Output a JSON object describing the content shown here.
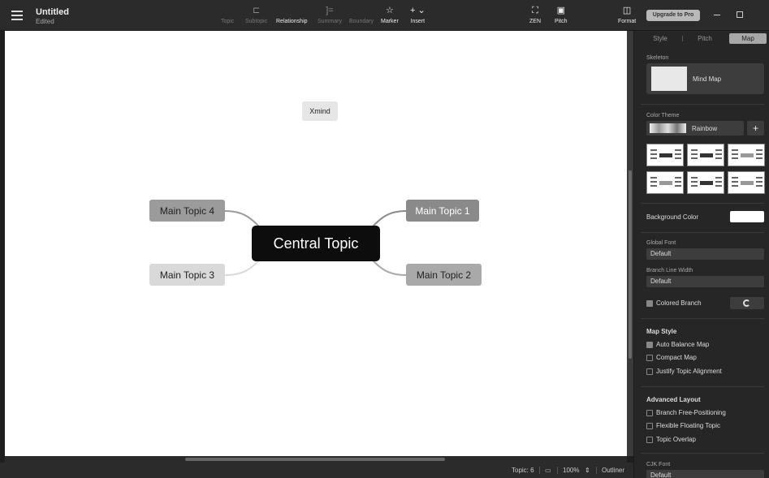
{
  "header": {
    "title": "Untitled",
    "status": "Edited",
    "upgrade_label": "Upgrade to Pro"
  },
  "toolbar": {
    "items": [
      {
        "label": "Topic",
        "icon": "topic-icon",
        "glyph": ""
      },
      {
        "label": "Subtopic",
        "icon": "subtopic-icon",
        "glyph": "⊏"
      },
      {
        "label": "Relationship",
        "icon": "relationship-icon",
        "glyph": ""
      },
      {
        "label": "Summary",
        "icon": "summary-icon",
        "glyph": "]="
      },
      {
        "label": "Boundary",
        "icon": "boundary-icon",
        "glyph": ""
      },
      {
        "label": "Marker",
        "icon": "star-icon",
        "glyph": "☆"
      },
      {
        "label": "Insert",
        "icon": "plus-icon",
        "glyph": "+ ⌄"
      },
      {
        "label": "ZEN",
        "icon": "zen-icon",
        "glyph": "⛶"
      },
      {
        "label": "Pitch",
        "icon": "pitch-icon",
        "glyph": "▣"
      },
      {
        "label": "Format",
        "icon": "format-icon",
        "glyph": "◫"
      }
    ]
  },
  "map": {
    "central": "Central Topic",
    "topics": [
      "Main Topic 1",
      "Main Topic 2",
      "Main Topic 3",
      "Main Topic 4"
    ],
    "floating": "Xmind"
  },
  "statusbar": {
    "topic_count": "Topic: 6",
    "zoom": "100%",
    "outliner": "Outliner"
  },
  "panel": {
    "tabs": [
      "Style",
      "Pitch",
      "Map"
    ],
    "skeleton_label": "Skeleton",
    "skeleton_value": "Mind Map",
    "color_theme_label": "Color Theme",
    "color_theme_value": "Rainbow",
    "background_color_label": "Background Color",
    "global_font_label": "Global Font",
    "global_font_value": "Default",
    "branch_line_width_label": "Branch Line Width",
    "branch_line_width_value": "Default",
    "colored_branch_label": "Colored Branch",
    "map_style_label": "Map Style",
    "map_style_options": [
      {
        "label": "Auto Balance Map",
        "checked": true
      },
      {
        "label": "Compact Map",
        "checked": false
      },
      {
        "label": "Justify Topic Alignment",
        "checked": false
      }
    ],
    "advanced_layout_label": "Advanced Layout",
    "advanced_layout_options": [
      {
        "label": "Branch Free-Positioning",
        "checked": false
      },
      {
        "label": "Flexible Floating Topic",
        "checked": false
      },
      {
        "label": "Topic Overlap",
        "checked": false
      }
    ],
    "cjk_font_label": "CJK Font",
    "cjk_font_value": "Default"
  }
}
